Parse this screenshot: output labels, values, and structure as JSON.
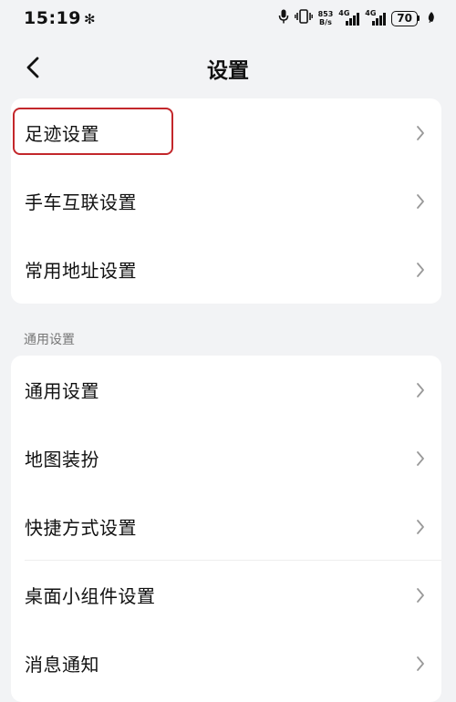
{
  "status_bar": {
    "time": "15:19",
    "bluetooth_glyph": "✻",
    "net_speed_value": "853",
    "net_speed_unit": "B/s",
    "network_1": "4G",
    "network_2": "4G",
    "battery": "70",
    "icons": [
      "bluetooth-icon",
      "microphone-icon",
      "vibrate-icon",
      "signal-icon",
      "battery-icon",
      "leaf-icon"
    ]
  },
  "nav": {
    "back_icon": "chevron-left-icon",
    "title": "设置"
  },
  "group1": {
    "items": [
      {
        "label": "足迹设置",
        "highlighted": true
      },
      {
        "label": "手车互联设置"
      },
      {
        "label": "常用地址设置"
      }
    ]
  },
  "group2": {
    "header": "通用设置",
    "items": [
      {
        "label": "通用设置"
      },
      {
        "label": "地图装扮"
      },
      {
        "label": "快捷方式设置"
      },
      {
        "label": "桌面小组件设置"
      },
      {
        "label": "消息通知"
      }
    ]
  },
  "colors": {
    "background": "#f2f3f5",
    "card": "#ffffff",
    "highlight": "#c3272b",
    "chevron": "#999999",
    "section_header": "#777777"
  }
}
